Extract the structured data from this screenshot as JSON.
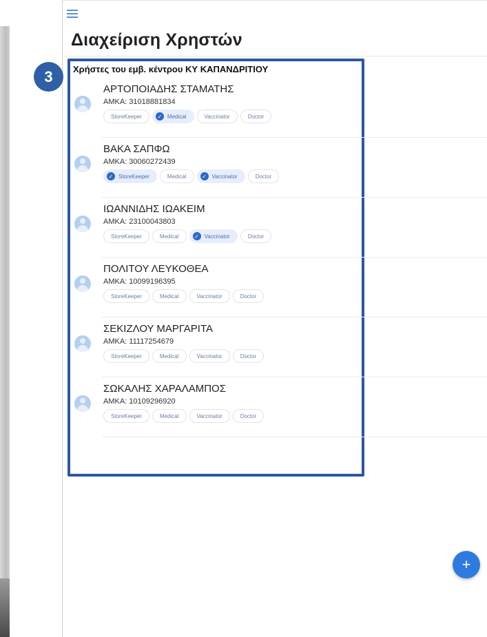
{
  "header": {
    "title": "Διαχείριση Χρηστών"
  },
  "annotation": {
    "step": "3"
  },
  "section": {
    "heading": "Χρήστες του εμβ. κέντρου ΚΥ ΚΑΠΑΝΔΡΙΤΙΟΥ"
  },
  "users": [
    {
      "name": "ΑΡΤΟΠΟΙΑΔΗΣ ΣΤΑΜΑΤΗΣ",
      "amka": "ΑΜΚΑ: 31018881834",
      "roles": [
        {
          "label": "StoreKeeper",
          "selected": false
        },
        {
          "label": "Medical",
          "selected": true
        },
        {
          "label": "Vaccinator",
          "selected": false
        },
        {
          "label": "Doctor",
          "selected": false
        }
      ]
    },
    {
      "name": "ΒΑΚΑ ΣΑΠΦΩ",
      "amka": "ΑΜΚΑ: 30060272439",
      "roles": [
        {
          "label": "StoreKeeper",
          "selected": true
        },
        {
          "label": "Medical",
          "selected": false
        },
        {
          "label": "Vaccinator",
          "selected": true
        },
        {
          "label": "Doctor",
          "selected": false
        }
      ]
    },
    {
      "name": "ΙΩΑΝΝΙΔΗΣ ΙΩΑΚΕΙΜ",
      "amka": "ΑΜΚΑ: 23100043803",
      "roles": [
        {
          "label": "StoreKeeper",
          "selected": false
        },
        {
          "label": "Medical",
          "selected": false
        },
        {
          "label": "Vaccinator",
          "selected": true
        },
        {
          "label": "Doctor",
          "selected": false
        }
      ]
    },
    {
      "name": "ΠΟΛΙΤΟΥ ΛΕΥΚΟΘΕΑ",
      "amka": "ΑΜΚΑ: 10099196395",
      "roles": [
        {
          "label": "StoreKeeper",
          "selected": false
        },
        {
          "label": "Medical",
          "selected": false
        },
        {
          "label": "Vaccinator",
          "selected": false
        },
        {
          "label": "Doctor",
          "selected": false
        }
      ]
    },
    {
      "name": "ΣΕΚΙΖΛΟΥ ΜΑΡΓΑΡΙΤΑ",
      "amka": "ΑΜΚΑ: 11117254679",
      "roles": [
        {
          "label": "StoreKeeper",
          "selected": false
        },
        {
          "label": "Medical",
          "selected": false
        },
        {
          "label": "Vaccinator",
          "selected": false
        },
        {
          "label": "Doctor",
          "selected": false
        }
      ]
    },
    {
      "name": "ΣΩΚΑΛΗΣ ΧΑΡΑΛΑΜΠΟΣ",
      "amka": "ΑΜΚΑ: 10109296920",
      "roles": [
        {
          "label": "StoreKeeper",
          "selected": false
        },
        {
          "label": "Medical",
          "selected": false
        },
        {
          "label": "Vaccinator",
          "selected": false
        },
        {
          "label": "Doctor",
          "selected": false
        }
      ]
    }
  ],
  "fab": {
    "icon": "plus-icon",
    "symbol": "+"
  },
  "colors": {
    "accent": "#2f67c7",
    "highlight_border": "#2b57a0",
    "fab": "#2f7ae0"
  }
}
